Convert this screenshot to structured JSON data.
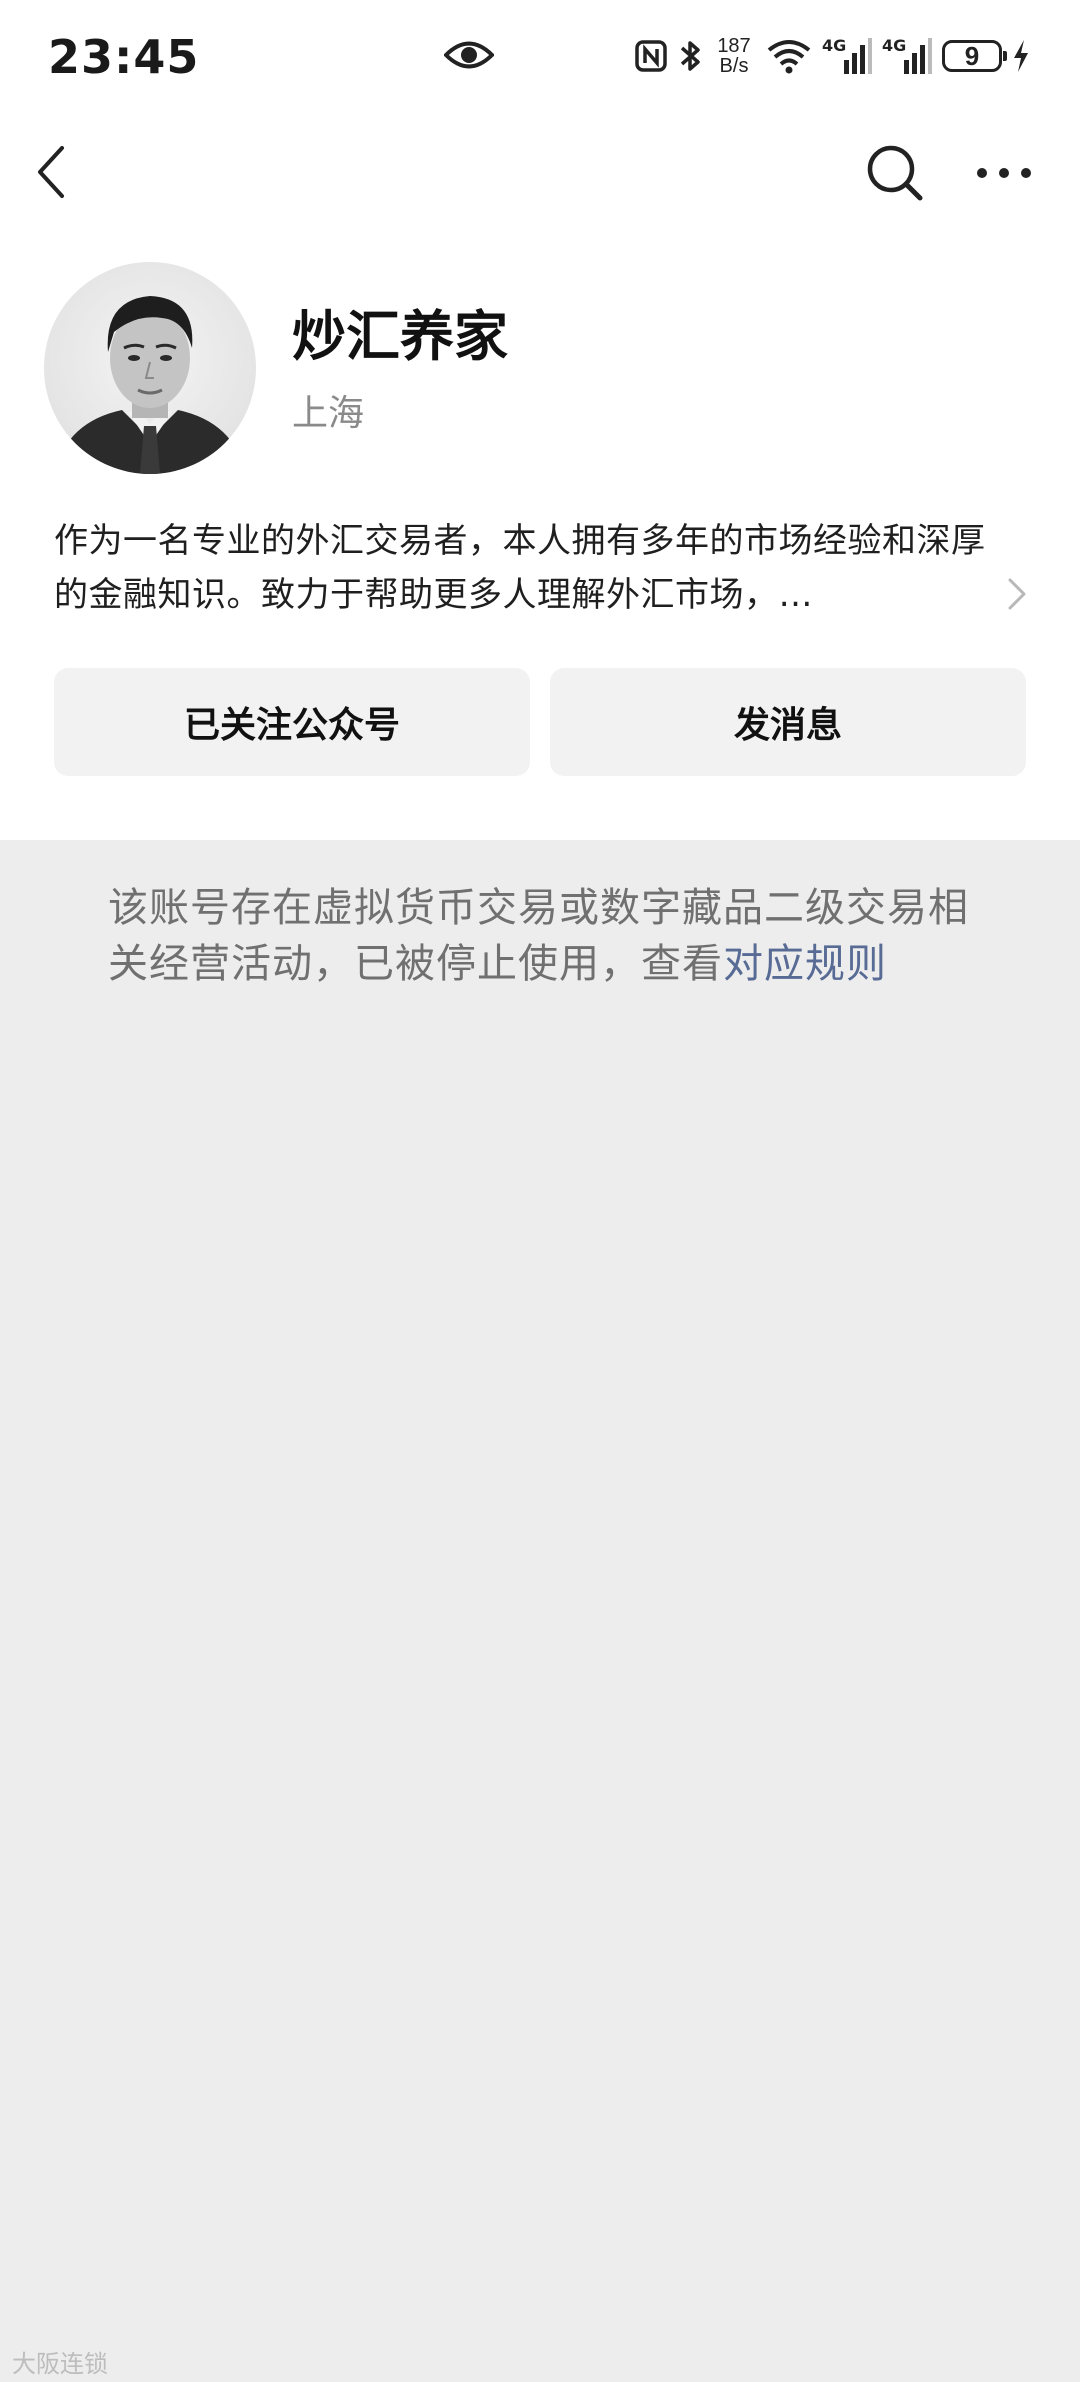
{
  "status_bar": {
    "time": "23:45",
    "net_speed_value": "187",
    "net_speed_unit": "B/s",
    "signal_1_label": "4G",
    "signal_2_label": "4G",
    "battery_level": "9",
    "icons": [
      "eye-icon",
      "nfc-icon",
      "bluetooth-icon",
      "wifi-icon",
      "signal-icon",
      "battery-icon",
      "charging-icon"
    ]
  },
  "nav": {
    "icons": [
      "back-arrow-icon",
      "search-icon",
      "more-icon"
    ]
  },
  "profile": {
    "name": "炒汇养家",
    "location": "上海",
    "description": "作为一名专业的外汇交易者，本人拥有多年的市场经验和深厚的金融知识。致力于帮助更多人理解外汇市场，…"
  },
  "actions": {
    "follow_label": "已关注公众号",
    "message_label": "发消息"
  },
  "notice": {
    "text": "该账号存在虚拟货币交易或数字藏品二级交易相关经营活动，已被停止使用，查看",
    "link_text": "对应规则",
    "link_color": "#576b95"
  },
  "watermark": "大阪连锁"
}
